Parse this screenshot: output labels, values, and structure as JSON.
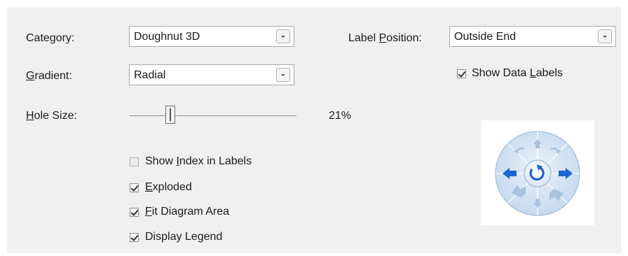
{
  "category": {
    "label": "Category:",
    "value": "Doughnut 3D"
  },
  "gradient": {
    "label_accel": "G",
    "label_rest": "radient:",
    "value": "Radial"
  },
  "hole_size": {
    "label_accel": "H",
    "label_rest": "ole Size:",
    "value_text": "21%",
    "value": 21
  },
  "label_position": {
    "label_pre": "Label ",
    "label_accel": "P",
    "label_rest": "osition:",
    "value": "Outside End"
  },
  "show_data_labels": {
    "pre": "Show Data ",
    "accel": "L",
    "rest": "abels",
    "checked": true
  },
  "options": [
    {
      "pre": "Show ",
      "accel": "I",
      "rest": "ndex in Labels",
      "checked": false
    },
    {
      "pre": "",
      "accel": "E",
      "rest": "xploded",
      "checked": true
    },
    {
      "pre": "",
      "accel": "F",
      "rest": "it Diagram Area",
      "checked": true
    },
    {
      "pre": "",
      "accel": "",
      "rest": "Display Legend",
      "checked": true
    }
  ],
  "rotation_control": {
    "buttons": [
      "tilt-up",
      "tilt-down",
      "rotate-left",
      "rotate-right",
      "rotate-ccw-up",
      "rotate-cw-up",
      "perspective-up-left",
      "perspective-down-right",
      "reset-rotation"
    ]
  },
  "colors": {
    "panel_bg": "#f0f0f0",
    "arrow_blue": "#1f63d6",
    "ring_blue": "#b7cfe6"
  }
}
